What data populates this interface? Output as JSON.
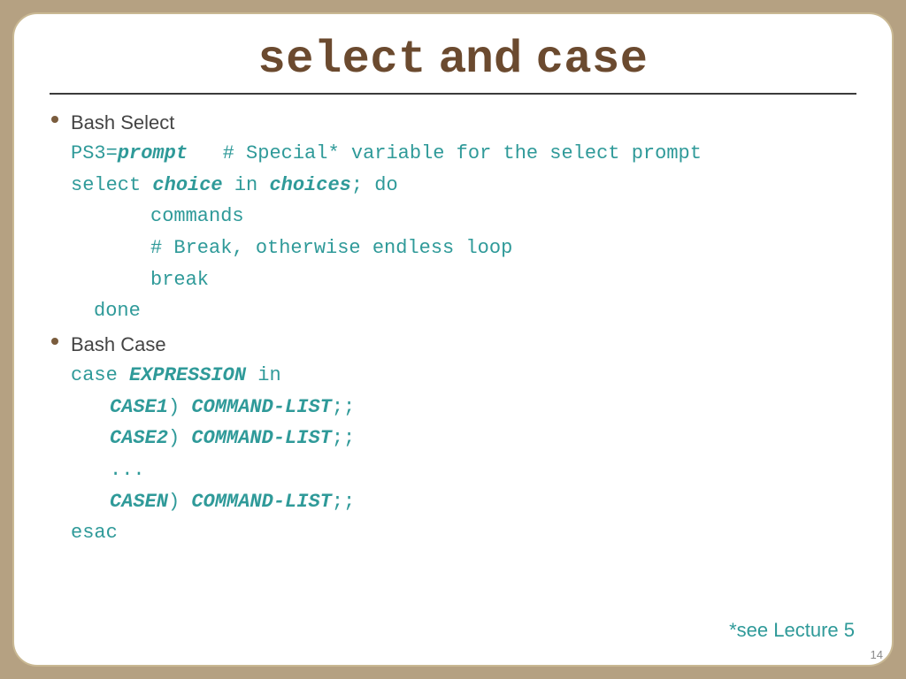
{
  "title": {
    "kw1": "select",
    "mid": " and ",
    "kw2": "case"
  },
  "bullets": {
    "select": {
      "head": "Bash Select",
      "l1a": "PS3=",
      "l1b": "prompt",
      "l1c": "   # Special* variable for the select prompt",
      "l2a": "select ",
      "l2b": "choice",
      "l2c": " in ",
      "l2d": "choices",
      "l2e": "; do",
      "l3": "commands",
      "l4": "# Break, otherwise endless loop",
      "l5": "break",
      "l6": "done"
    },
    "case": {
      "head": "Bash Case",
      "l1a": "case ",
      "l1b": "EXPRESSION",
      "l1c": " in",
      "l2a": "CASE1",
      "l2b": ") ",
      "l2c": "COMMAND-LIST",
      "l2d": ";;",
      "l3a": "CASE2",
      "l3b": ") ",
      "l3c": "COMMAND-LIST",
      "l3d": ";;",
      "l4": "...",
      "l5a": "CASEN",
      "l5b": ") ",
      "l5c": "COMMAND-LIST",
      "l5d": ";;",
      "l6": "esac"
    }
  },
  "footer": "*see Lecture 5",
  "page": "14"
}
